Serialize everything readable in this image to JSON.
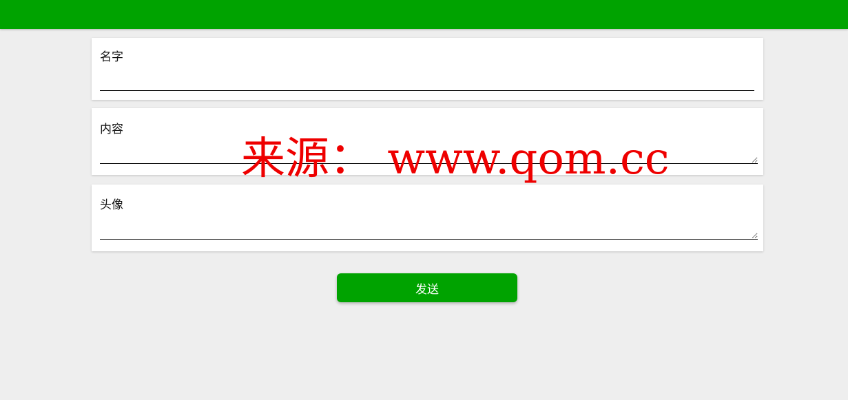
{
  "form": {
    "name_label": "名字",
    "name_value": "",
    "content_label": "内容",
    "content_value": "",
    "avatar_label": "头像",
    "avatar_value": "",
    "send_label": "发送"
  },
  "watermark": {
    "text": "来源：  www.qom.cc"
  },
  "colors": {
    "primary_green": "#00a300",
    "background": "#eeeeee",
    "watermark_red": "#ee0000"
  }
}
